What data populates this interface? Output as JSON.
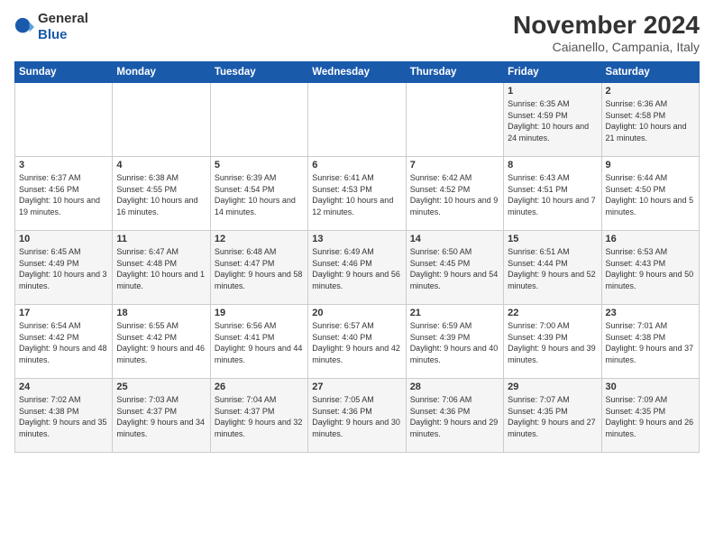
{
  "logo": {
    "general": "General",
    "blue": "Blue"
  },
  "header": {
    "month": "November 2024",
    "location": "Caianello, Campania, Italy"
  },
  "weekdays": [
    "Sunday",
    "Monday",
    "Tuesday",
    "Wednesday",
    "Thursday",
    "Friday",
    "Saturday"
  ],
  "weeks": [
    [
      {
        "day": "",
        "sunrise": "",
        "sunset": "",
        "daylight": ""
      },
      {
        "day": "",
        "sunrise": "",
        "sunset": "",
        "daylight": ""
      },
      {
        "day": "",
        "sunrise": "",
        "sunset": "",
        "daylight": ""
      },
      {
        "day": "",
        "sunrise": "",
        "sunset": "",
        "daylight": ""
      },
      {
        "day": "",
        "sunrise": "",
        "sunset": "",
        "daylight": ""
      },
      {
        "day": "1",
        "sunrise": "Sunrise: 6:35 AM",
        "sunset": "Sunset: 4:59 PM",
        "daylight": "Daylight: 10 hours and 24 minutes."
      },
      {
        "day": "2",
        "sunrise": "Sunrise: 6:36 AM",
        "sunset": "Sunset: 4:58 PM",
        "daylight": "Daylight: 10 hours and 21 minutes."
      }
    ],
    [
      {
        "day": "3",
        "sunrise": "Sunrise: 6:37 AM",
        "sunset": "Sunset: 4:56 PM",
        "daylight": "Daylight: 10 hours and 19 minutes."
      },
      {
        "day": "4",
        "sunrise": "Sunrise: 6:38 AM",
        "sunset": "Sunset: 4:55 PM",
        "daylight": "Daylight: 10 hours and 16 minutes."
      },
      {
        "day": "5",
        "sunrise": "Sunrise: 6:39 AM",
        "sunset": "Sunset: 4:54 PM",
        "daylight": "Daylight: 10 hours and 14 minutes."
      },
      {
        "day": "6",
        "sunrise": "Sunrise: 6:41 AM",
        "sunset": "Sunset: 4:53 PM",
        "daylight": "Daylight: 10 hours and 12 minutes."
      },
      {
        "day": "7",
        "sunrise": "Sunrise: 6:42 AM",
        "sunset": "Sunset: 4:52 PM",
        "daylight": "Daylight: 10 hours and 9 minutes."
      },
      {
        "day": "8",
        "sunrise": "Sunrise: 6:43 AM",
        "sunset": "Sunset: 4:51 PM",
        "daylight": "Daylight: 10 hours and 7 minutes."
      },
      {
        "day": "9",
        "sunrise": "Sunrise: 6:44 AM",
        "sunset": "Sunset: 4:50 PM",
        "daylight": "Daylight: 10 hours and 5 minutes."
      }
    ],
    [
      {
        "day": "10",
        "sunrise": "Sunrise: 6:45 AM",
        "sunset": "Sunset: 4:49 PM",
        "daylight": "Daylight: 10 hours and 3 minutes."
      },
      {
        "day": "11",
        "sunrise": "Sunrise: 6:47 AM",
        "sunset": "Sunset: 4:48 PM",
        "daylight": "Daylight: 10 hours and 1 minute."
      },
      {
        "day": "12",
        "sunrise": "Sunrise: 6:48 AM",
        "sunset": "Sunset: 4:47 PM",
        "daylight": "Daylight: 9 hours and 58 minutes."
      },
      {
        "day": "13",
        "sunrise": "Sunrise: 6:49 AM",
        "sunset": "Sunset: 4:46 PM",
        "daylight": "Daylight: 9 hours and 56 minutes."
      },
      {
        "day": "14",
        "sunrise": "Sunrise: 6:50 AM",
        "sunset": "Sunset: 4:45 PM",
        "daylight": "Daylight: 9 hours and 54 minutes."
      },
      {
        "day": "15",
        "sunrise": "Sunrise: 6:51 AM",
        "sunset": "Sunset: 4:44 PM",
        "daylight": "Daylight: 9 hours and 52 minutes."
      },
      {
        "day": "16",
        "sunrise": "Sunrise: 6:53 AM",
        "sunset": "Sunset: 4:43 PM",
        "daylight": "Daylight: 9 hours and 50 minutes."
      }
    ],
    [
      {
        "day": "17",
        "sunrise": "Sunrise: 6:54 AM",
        "sunset": "Sunset: 4:42 PM",
        "daylight": "Daylight: 9 hours and 48 minutes."
      },
      {
        "day": "18",
        "sunrise": "Sunrise: 6:55 AM",
        "sunset": "Sunset: 4:42 PM",
        "daylight": "Daylight: 9 hours and 46 minutes."
      },
      {
        "day": "19",
        "sunrise": "Sunrise: 6:56 AM",
        "sunset": "Sunset: 4:41 PM",
        "daylight": "Daylight: 9 hours and 44 minutes."
      },
      {
        "day": "20",
        "sunrise": "Sunrise: 6:57 AM",
        "sunset": "Sunset: 4:40 PM",
        "daylight": "Daylight: 9 hours and 42 minutes."
      },
      {
        "day": "21",
        "sunrise": "Sunrise: 6:59 AM",
        "sunset": "Sunset: 4:39 PM",
        "daylight": "Daylight: 9 hours and 40 minutes."
      },
      {
        "day": "22",
        "sunrise": "Sunrise: 7:00 AM",
        "sunset": "Sunset: 4:39 PM",
        "daylight": "Daylight: 9 hours and 39 minutes."
      },
      {
        "day": "23",
        "sunrise": "Sunrise: 7:01 AM",
        "sunset": "Sunset: 4:38 PM",
        "daylight": "Daylight: 9 hours and 37 minutes."
      }
    ],
    [
      {
        "day": "24",
        "sunrise": "Sunrise: 7:02 AM",
        "sunset": "Sunset: 4:38 PM",
        "daylight": "Daylight: 9 hours and 35 minutes."
      },
      {
        "day": "25",
        "sunrise": "Sunrise: 7:03 AM",
        "sunset": "Sunset: 4:37 PM",
        "daylight": "Daylight: 9 hours and 34 minutes."
      },
      {
        "day": "26",
        "sunrise": "Sunrise: 7:04 AM",
        "sunset": "Sunset: 4:37 PM",
        "daylight": "Daylight: 9 hours and 32 minutes."
      },
      {
        "day": "27",
        "sunrise": "Sunrise: 7:05 AM",
        "sunset": "Sunset: 4:36 PM",
        "daylight": "Daylight: 9 hours and 30 minutes."
      },
      {
        "day": "28",
        "sunrise": "Sunrise: 7:06 AM",
        "sunset": "Sunset: 4:36 PM",
        "daylight": "Daylight: 9 hours and 29 minutes."
      },
      {
        "day": "29",
        "sunrise": "Sunrise: 7:07 AM",
        "sunset": "Sunset: 4:35 PM",
        "daylight": "Daylight: 9 hours and 27 minutes."
      },
      {
        "day": "30",
        "sunrise": "Sunrise: 7:09 AM",
        "sunset": "Sunset: 4:35 PM",
        "daylight": "Daylight: 9 hours and 26 minutes."
      }
    ]
  ]
}
